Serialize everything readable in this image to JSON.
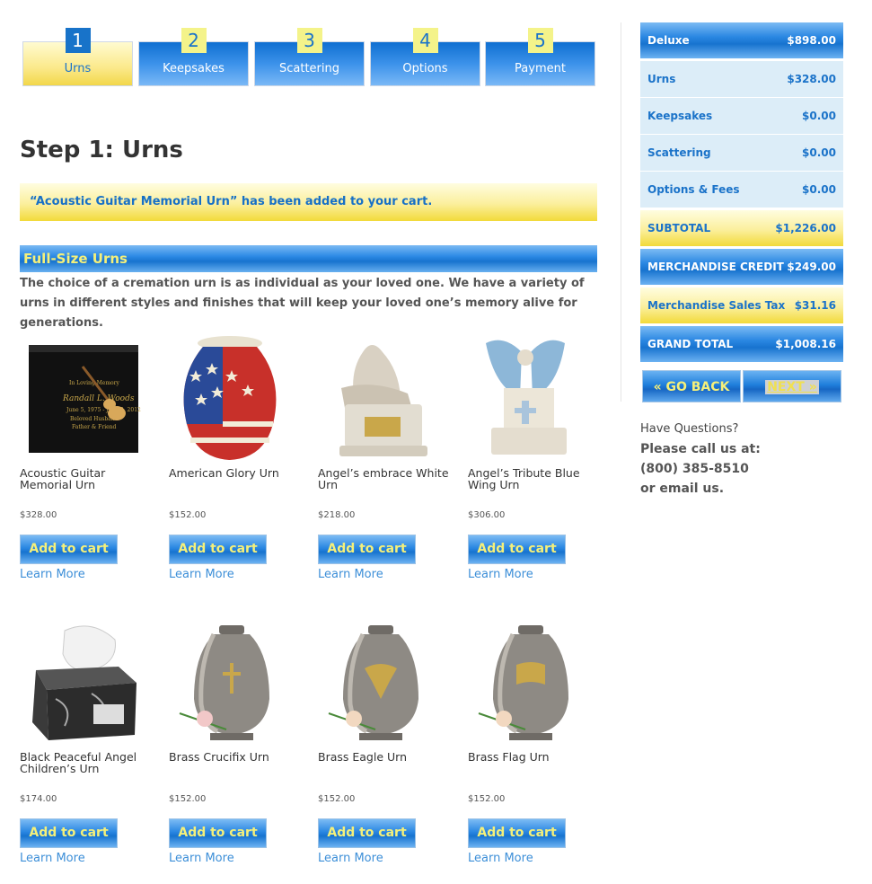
{
  "steps": [
    {
      "num": "1",
      "label": "Urns",
      "active": true
    },
    {
      "num": "2",
      "label": "Keepsakes"
    },
    {
      "num": "3",
      "label": "Scattering"
    },
    {
      "num": "4",
      "label": "Options"
    },
    {
      "num": "5",
      "label": "Payment"
    }
  ],
  "page_title": "Step 1: Urns",
  "notice": "“Acoustic Guitar Memorial Urn” has been added to your cart.",
  "section": {
    "title": "Full-Size Urns",
    "intro": "The choice of a cremation urn is as individual as your loved one.  We have a variety of urns in different styles and finishes that will keep your loved one’s memory alive for generations."
  },
  "products": [
    {
      "name": "Acoustic Guitar Memorial Urn",
      "price": "$328.00",
      "add": "Add to cart",
      "learn": "Learn More",
      "icon": "black-box-urn-guitar"
    },
    {
      "name": "American Glory Urn",
      "price": "$152.00",
      "add": "Add to cart",
      "learn": "Learn More",
      "icon": "flag-urn"
    },
    {
      "name": "Angel’s embrace White Urn",
      "price": "$218.00",
      "add": "Add to cart",
      "learn": "Learn More",
      "icon": "pieta-statue-urn"
    },
    {
      "name": "Angel’s Tribute Blue Wing Urn",
      "price": "$306.00",
      "add": "Add to cart",
      "learn": "Learn More",
      "icon": "angel-wing-urn"
    },
    {
      "name": "Black Peaceful Angel Children’s Urn",
      "price": "$174.00",
      "add": "Add to cart",
      "learn": "Learn More",
      "icon": "marble-angel-urn"
    },
    {
      "name": "Brass Crucifix Urn",
      "price": "$152.00",
      "add": "Add to cart",
      "learn": "Learn More",
      "icon": "brass-urn-crucifix"
    },
    {
      "name": "Brass Eagle Urn",
      "price": "$152.00",
      "add": "Add to cart",
      "learn": "Learn More",
      "icon": "brass-urn-eagle"
    },
    {
      "name": "Brass Flag Urn",
      "price": "$152.00",
      "add": "Add to cart",
      "learn": "Learn More",
      "icon": "brass-urn-flag"
    }
  ],
  "summary": [
    {
      "label": "Deluxe",
      "value": "$898.00",
      "style": "blue"
    },
    {
      "label": "Urns",
      "value": "$328.00",
      "style": "light"
    },
    {
      "label": "Keepsakes",
      "value": "$0.00",
      "style": "light"
    },
    {
      "label": "Scattering",
      "value": "$0.00",
      "style": "light"
    },
    {
      "label": "Options & Fees",
      "value": "$0.00",
      "style": "light"
    },
    {
      "label": "SUBTOTAL",
      "value": "$1,226.00",
      "style": "yellow"
    },
    {
      "label": "MERCHANDISE CREDIT",
      "value": "$249.00",
      "style": "blue"
    },
    {
      "label": "Merchandise Sales Tax",
      "value": "$31.16",
      "style": "yellow"
    },
    {
      "label": "GRAND TOTAL",
      "value": "$1,008.16",
      "style": "blue"
    }
  ],
  "nav": {
    "back": "« GO BACK",
    "next": "NEXT »"
  },
  "questions": {
    "heading": "Have Questions?",
    "line1": "Please call us at:",
    "phone": "(800) 385-8510",
    "line3": "or email us."
  },
  "colors": {
    "accent_blue": "#1773cf",
    "accent_yellow": "#f5f07a",
    "link": "#3d8fd8"
  }
}
